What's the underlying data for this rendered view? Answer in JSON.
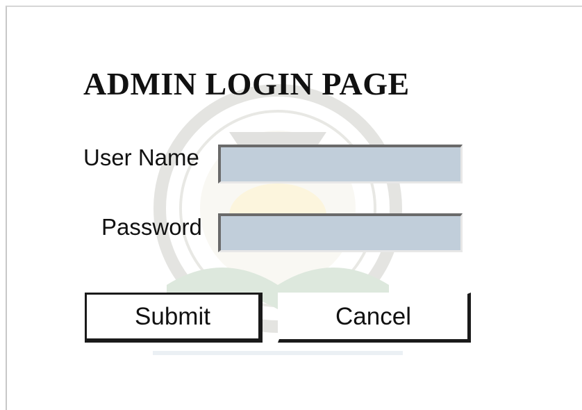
{
  "form": {
    "title": "ADMIN LOGIN PAGE",
    "username_label": "User Name",
    "username_value": "",
    "password_label": "Password",
    "password_value": "",
    "submit_label": "Submit",
    "cancel_label": "Cancel"
  },
  "colors": {
    "field_background": "#c1ceda",
    "text": "#111111",
    "page_background": "#ffffff"
  },
  "icons": {
    "watermark": "university-seal-watermark"
  }
}
